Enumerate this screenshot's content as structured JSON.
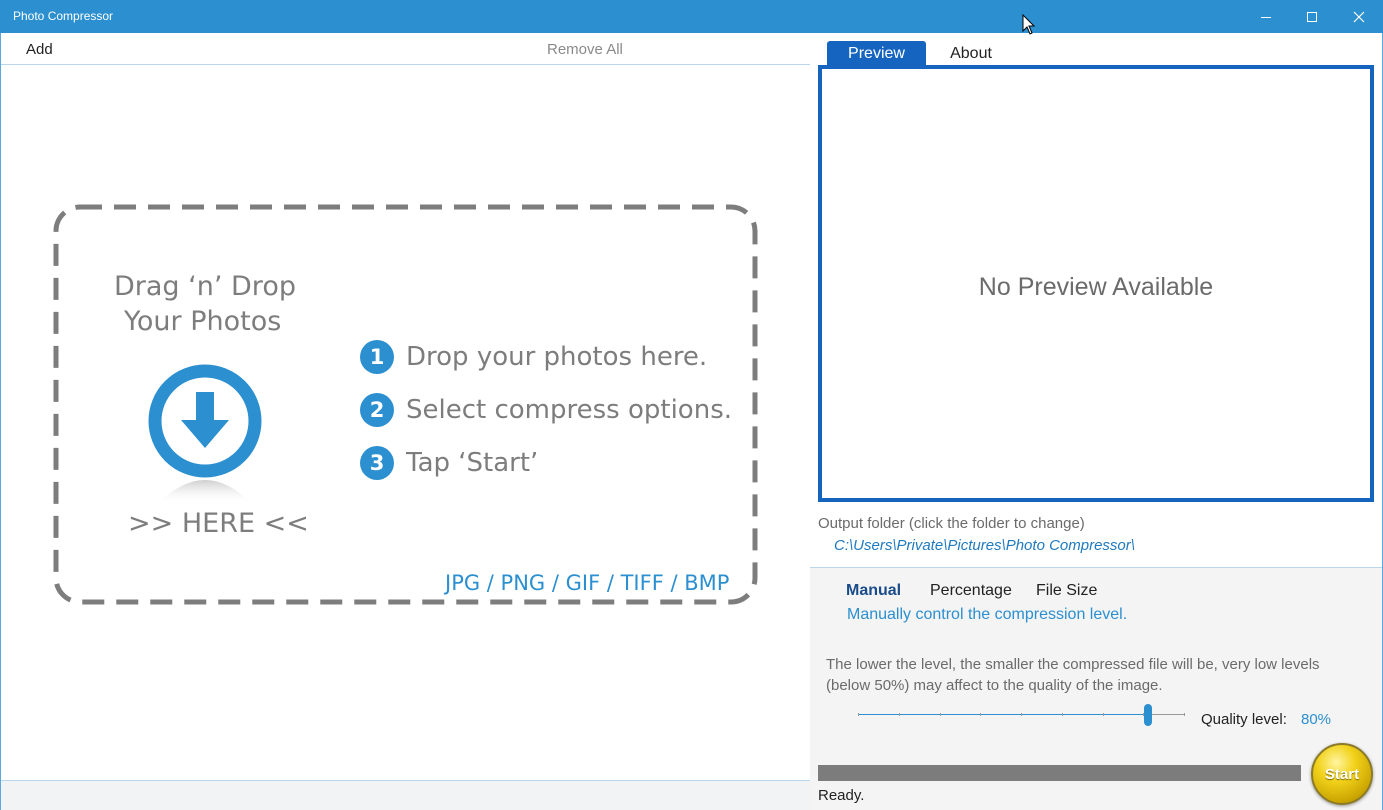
{
  "window": {
    "title": "Photo Compressor",
    "controls": [
      "minimize-icon",
      "maximize-icon",
      "close-icon"
    ],
    "accent_color": "#2b8fd0"
  },
  "left_panel": {
    "toolbar": {
      "add_label": "Add",
      "remove_all_label": "Remove All"
    },
    "drop_zone": {
      "title_line_1": "Drag ‘n’ Drop",
      "title_line_2": "Your Photos",
      "here_label": ">> HERE <<",
      "icon": "download-arrow-icon",
      "steps": [
        {
          "number": "1",
          "text": "Drop your photos here."
        },
        {
          "number": "2",
          "text": "Select compress options."
        },
        {
          "number": "3",
          "text": "Tap ‘Start’"
        }
      ],
      "formats": "JPG / PNG / GIF / TIFF / BMP"
    }
  },
  "right_panel": {
    "tabs": [
      {
        "label": "Preview",
        "active": true
      },
      {
        "label": "About",
        "active": false
      }
    ],
    "preview": {
      "empty_text": "No Preview Available",
      "border_color": "#1565c0"
    },
    "output": {
      "label": "Output folder (click the folder to change)",
      "path": "C:\\Users\\Private\\Pictures\\Photo Compressor\\"
    },
    "options": {
      "modes": [
        {
          "label": "Manual",
          "active": true
        },
        {
          "label": "Percentage",
          "active": false
        },
        {
          "label": "File Size",
          "active": false
        }
      ],
      "mode_description": "Manually control the compression level.",
      "hint": "The lower the level, the smaller the compressed file will be, very low levels (below 50%) may affect to the quality of the image.",
      "quality_label": "Quality level:",
      "quality_value": "80%",
      "quality_level": 0.89,
      "slider_ticks": 8
    },
    "progress": {
      "fraction": 0,
      "status": "Ready."
    },
    "start_label": "Start"
  }
}
